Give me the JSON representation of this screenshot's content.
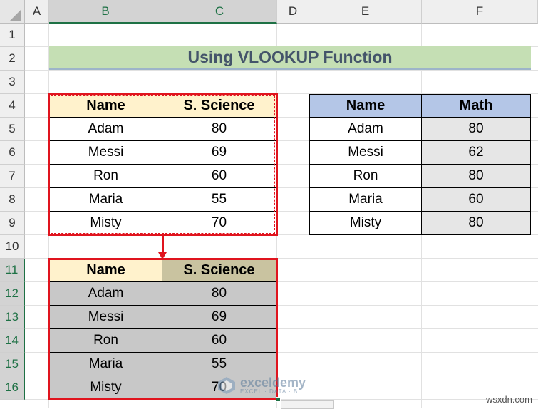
{
  "columns": [
    "A",
    "B",
    "C",
    "D",
    "E",
    "F"
  ],
  "rows": [
    "1",
    "2",
    "3",
    "4",
    "5",
    "6",
    "7",
    "8",
    "9",
    "10",
    "11",
    "12",
    "13",
    "14",
    "15",
    "16"
  ],
  "title": "Using VLOOKUP Function",
  "table1": {
    "headers": [
      "Name",
      "S. Science"
    ],
    "rows": [
      [
        "Adam",
        "80"
      ],
      [
        "Messi",
        "69"
      ],
      [
        "Ron",
        "60"
      ],
      [
        "Maria",
        "55"
      ],
      [
        "Misty",
        "70"
      ]
    ]
  },
  "table2": {
    "headers": [
      "Name",
      "Math"
    ],
    "rows": [
      [
        "Adam",
        "80"
      ],
      [
        "Messi",
        "62"
      ],
      [
        "Ron",
        "80"
      ],
      [
        "Maria",
        "60"
      ],
      [
        "Misty",
        "80"
      ]
    ]
  },
  "table3": {
    "headers": [
      "Name",
      "S. Science"
    ],
    "rows": [
      [
        "Adam",
        "80"
      ],
      [
        "Messi",
        "69"
      ],
      [
        "Ron",
        "60"
      ],
      [
        "Maria",
        "55"
      ],
      [
        "Misty",
        "70"
      ]
    ]
  },
  "watermark": {
    "name": "exceldemy",
    "sub": "EXCEL · DATA · BI"
  },
  "site": "wsxdn.com",
  "colors": {
    "title_bg": "#c5dfb4",
    "title_text": "#44546a",
    "table1_header_bg": "#fff2cc",
    "table2_header_bg": "#b4c6e7",
    "table3_header_left_bg": "#fff2cc",
    "table3_header_right_bg": "#c9c3a0",
    "table3_body_bg": "#c8c8c8",
    "table2_math_bg": "#e6e6e6",
    "highlight_border": "#e0141e",
    "selection_green": "#1e7145"
  }
}
